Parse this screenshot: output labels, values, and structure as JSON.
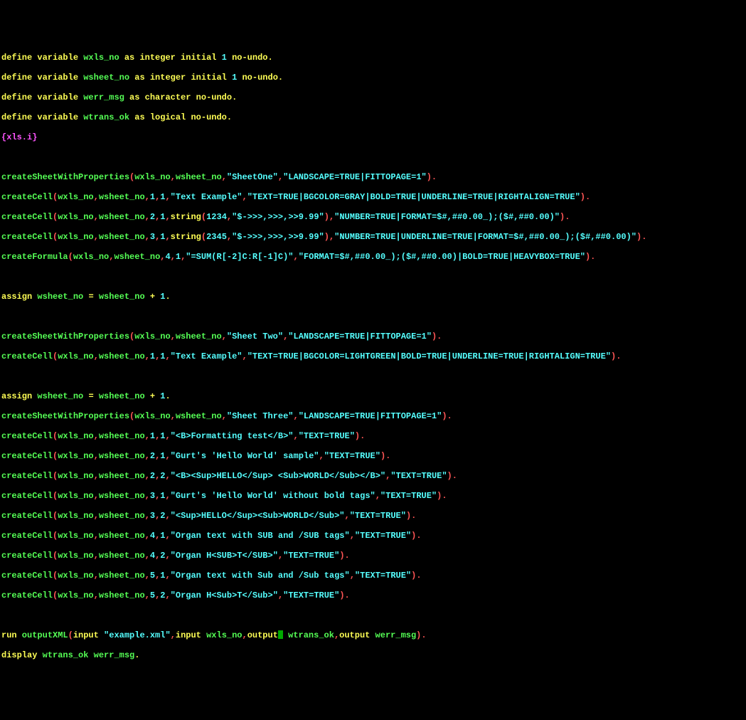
{
  "code": {
    "l1": {
      "a": "define variable",
      "b": " wxls_no ",
      "c": "as integer initial",
      "d": " 1 ",
      "e": "no-undo."
    },
    "l2": {
      "a": "define variable",
      "b": " wsheet_no ",
      "c": "as integer initial",
      "d": " 1 ",
      "e": "no-undo."
    },
    "l3": {
      "a": "define variable",
      "b": " werr_msg ",
      "c": "as character no-undo."
    },
    "l4": {
      "a": "define variable",
      "b": " wtrans_ok ",
      "c": "as logical no-undo."
    },
    "l5": {
      "a": "{",
      "b": "xls.i",
      "c": "}"
    },
    "l6": "",
    "l7": {
      "a": "createSheetWithProperties",
      "b": "(",
      "c": "wxls_no",
      "d": ",",
      "e": "wsheet_no",
      "f": ",",
      "g": "\"SheetOne\"",
      "h": ",",
      "i": "\"LANDSCAPE=TRUE|FITTOPAGE=1\"",
      "j": ")."
    },
    "l8": {
      "a": "createCell",
      "b": "(",
      "c": "wxls_no",
      "d": ",",
      "e": "wsheet_no",
      "f": ",",
      "g": "1",
      "h": ",",
      "i": "1",
      "j": ",",
      "k": "\"Text Example\"",
      "l": ",",
      "m": "\"TEXT=TRUE|BGCOLOR=GRAY|BOLD=TRUE|UNDERLINE=TRUE|RIGHTALIGN=TRUE\"",
      "n": ")."
    },
    "l9": {
      "a": "createCell",
      "b": "(",
      "c": "wxls_no",
      "d": ",",
      "e": "wsheet_no",
      "f": ",",
      "g": "2",
      "h": ",",
      "i": "1",
      "j": ",",
      "k": "string",
      "l": "(",
      "m": "1234",
      "n": ",",
      "o": "\"$->>>,>>>,>>9.99\"",
      "p": "),",
      "q": "\"NUMBER=TRUE|FORMAT=$#,##0.00_);($#,##0.00)\"",
      "r": ")."
    },
    "l10": {
      "a": "createCell",
      "b": "(",
      "c": "wxls_no",
      "d": ",",
      "e": "wsheet_no",
      "f": ",",
      "g": "3",
      "h": ",",
      "i": "1",
      "j": ",",
      "k": "string",
      "l": "(",
      "m": "2345",
      "n": ",",
      "o": "\"$->>>,>>>,>>9.99\"",
      "p": "),",
      "q": "\"NUMBER=TRUE|UNDERLINE=TRUE|FORMAT=$#,##0.00_);($#,##0.00)\"",
      "r": ")."
    },
    "l11": {
      "a": "createFormula",
      "b": "(",
      "c": "wxls_no",
      "d": ",",
      "e": "wsheet_no",
      "f": ",",
      "g": "4",
      "h": ",",
      "i": "1",
      "j": ",",
      "k": "\"=SUM(R[-2]C:R[-1]C)\"",
      "l": ",",
      "m": "\"FORMAT=$#,##0.00_);($#,##0.00)|BOLD=TRUE|HEAVYBOX=TRUE\"",
      "n": ")."
    },
    "l12": "",
    "l13": {
      "a": "assign",
      "b": " wsheet_no ",
      "c": "=",
      "d": " wsheet_no ",
      "e": "+",
      "f": " 1",
      "g": "."
    },
    "l14": "",
    "l15": {
      "a": "createSheetWithProperties",
      "b": "(",
      "c": "wxls_no",
      "d": ",",
      "e": "wsheet_no",
      "f": ",",
      "g": "\"Sheet Two\"",
      "h": ",",
      "i": "\"LANDSCAPE=TRUE|FITTOPAGE=1\"",
      "j": ")."
    },
    "l16": {
      "a": "createCell",
      "b": "(",
      "c": "wxls_no",
      "d": ",",
      "e": "wsheet_no",
      "f": ",",
      "g": "1",
      "h": ",",
      "i": "1",
      "j": ",",
      "k": "\"Text Example\"",
      "l": ",",
      "m": "\"TEXT=TRUE|BGCOLOR=LIGHTGREEN|BOLD=TRUE|UNDERLINE=TRUE|RIGHTALIGN=TRUE\"",
      "n": ")."
    },
    "l17": "",
    "l18": {
      "a": "assign",
      "b": " wsheet_no ",
      "c": "=",
      "d": " wsheet_no ",
      "e": "+",
      "f": " 1",
      "g": "."
    },
    "l19": {
      "a": "createSheetWithProperties",
      "b": "(",
      "c": "wxls_no",
      "d": ",",
      "e": "wsheet_no",
      "f": ",",
      "g": "\"Sheet Three\"",
      "h": ",",
      "i": "\"LANDSCAPE=TRUE|FITTOPAGE=1\"",
      "j": ")."
    },
    "l20": {
      "a": "createCell",
      "b": "(",
      "c": "wxls_no",
      "d": ",",
      "e": "wsheet_no",
      "f": ",",
      "g": "1",
      "h": ",",
      "i": "1",
      "j": ",",
      "k": "\"<B>Formatting test</B>\"",
      "l": ",",
      "m": "\"TEXT=TRUE\"",
      "n": ")."
    },
    "l21": {
      "a": "createCell",
      "b": "(",
      "c": "wxls_no",
      "d": ",",
      "e": "wsheet_no",
      "f": ",",
      "g": "2",
      "h": ",",
      "i": "1",
      "j": ",",
      "k": "\"Gurt's 'Hello World' sample\"",
      "l": ",",
      "m": "\"TEXT=TRUE\"",
      "n": ")."
    },
    "l22": {
      "a": "createCell",
      "b": "(",
      "c": "wxls_no",
      "d": ",",
      "e": "wsheet_no",
      "f": ",",
      "g": "2",
      "h": ",",
      "i": "2",
      "j": ",",
      "k": "\"<B><Sup>HELLO</Sup> <Sub>WORLD</Sub></B>\"",
      "l": ",",
      "m": "\"TEXT=TRUE\"",
      "n": ")."
    },
    "l23": {
      "a": "createCell",
      "b": "(",
      "c": "wxls_no",
      "d": ",",
      "e": "wsheet_no",
      "f": ",",
      "g": "3",
      "h": ",",
      "i": "1",
      "j": ",",
      "k": "\"Gurt's 'Hello World' without bold tags\"",
      "l": ",",
      "m": "\"TEXT=TRUE\"",
      "n": ")."
    },
    "l24": {
      "a": "createCell",
      "b": "(",
      "c": "wxls_no",
      "d": ",",
      "e": "wsheet_no",
      "f": ",",
      "g": "3",
      "h": ",",
      "i": "2",
      "j": ",",
      "k": "\"<Sup>HELLO</Sup><Sub>WORLD</Sub>\"",
      "l": ",",
      "m": "\"TEXT=TRUE\"",
      "n": ")."
    },
    "l25": {
      "a": "createCell",
      "b": "(",
      "c": "wxls_no",
      "d": ",",
      "e": "wsheet_no",
      "f": ",",
      "g": "4",
      "h": ",",
      "i": "1",
      "j": ",",
      "k": "\"Organ text with SUB and /SUB tags\"",
      "l": ",",
      "m": "\"TEXT=TRUE\"",
      "n": ")."
    },
    "l26": {
      "a": "createCell",
      "b": "(",
      "c": "wxls_no",
      "d": ",",
      "e": "wsheet_no",
      "f": ",",
      "g": "4",
      "h": ",",
      "i": "2",
      "j": ",",
      "k": "\"Organ H<SUB>T</SUB>\"",
      "l": ",",
      "m": "\"TEXT=TRUE\"",
      "n": ")."
    },
    "l27": {
      "a": "createCell",
      "b": "(",
      "c": "wxls_no",
      "d": ",",
      "e": "wsheet_no",
      "f": ",",
      "g": "5",
      "h": ",",
      "i": "1",
      "j": ",",
      "k": "\"Organ text with Sub and /Sub tags\"",
      "l": ",",
      "m": "\"TEXT=TRUE\"",
      "n": ")."
    },
    "l28": {
      "a": "createCell",
      "b": "(",
      "c": "wxls_no",
      "d": ",",
      "e": "wsheet_no",
      "f": ",",
      "g": "5",
      "h": ",",
      "i": "2",
      "j": ",",
      "k": "\"Organ H<Sub>T</Sub>\"",
      "l": ",",
      "m": "\"TEXT=TRUE\"",
      "n": ")."
    },
    "l29": "",
    "l30": {
      "a": "run",
      "b": " outputXML",
      "c": "(",
      "d": "input",
      "e": " ",
      "f": "\"example.xml\"",
      "g": ",",
      "h": "input",
      "i": " wxls_no",
      "j": ",",
      "k": "output",
      "l": " wtrans_ok",
      "m": ",",
      "n": "output",
      "o": " werr_msg",
      "p": ")."
    },
    "l31": {
      "a": "display",
      "b": " wtrans_ok werr_msg",
      "c": "."
    }
  }
}
